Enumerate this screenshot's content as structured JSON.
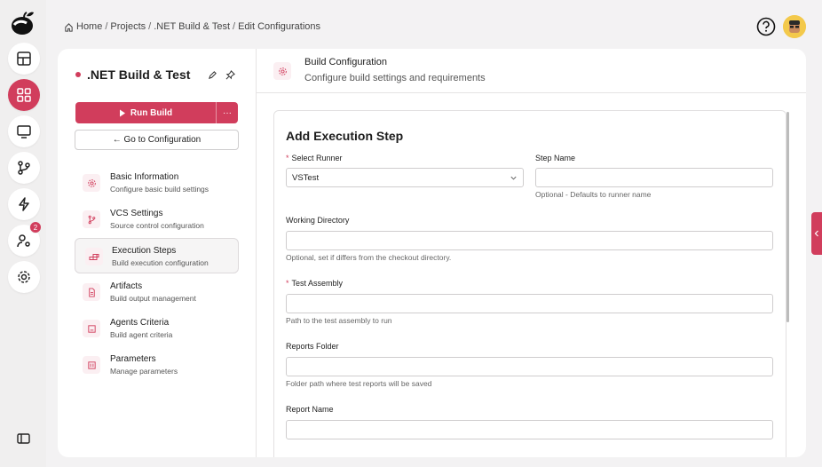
{
  "breadcrumb": [
    "Home",
    "Projects",
    ".NET Build & Test",
    "Edit Configurations"
  ],
  "sidebar": {
    "badge_count": "2"
  },
  "project": {
    "title": ".NET Build & Test",
    "run_label": "Run Build",
    "more_label": "···",
    "goto_label": "← Go to Configuration"
  },
  "nav": [
    {
      "title": "Basic Information",
      "subtitle": "Configure basic build settings",
      "icon": "gear-icon"
    },
    {
      "title": "VCS Settings",
      "subtitle": "Source control configuration",
      "icon": "branch-icon"
    },
    {
      "title": "Execution Steps",
      "subtitle": "Build execution configuration",
      "icon": "steps-icon",
      "active": true
    },
    {
      "title": "Artifacts",
      "subtitle": "Build output management",
      "icon": "file-icon"
    },
    {
      "title": "Agents Criteria",
      "subtitle": "Build agent criteria",
      "icon": "agent-icon"
    },
    {
      "title": "Parameters",
      "subtitle": "Manage parameters",
      "icon": "params-icon"
    }
  ],
  "header": {
    "title": "Build Configuration",
    "subtitle": "Configure build settings and requirements"
  },
  "form": {
    "title": "Add Execution Step",
    "runner": {
      "label": "Select Runner",
      "value": "VSTest"
    },
    "step_name": {
      "label": "Step Name",
      "hint": "Optional - Defaults to runner name"
    },
    "working_dir": {
      "label": "Working Directory",
      "hint": "Optional, set if differs from the checkout directory."
    },
    "test_assembly": {
      "label": "Test Assembly",
      "hint": "Path to the test assembly to run"
    },
    "reports_folder": {
      "label": "Reports Folder",
      "hint": "Folder path where test reports will be saved"
    },
    "report_name": {
      "label": "Report Name"
    }
  },
  "colors": {
    "accent": "#d13d5c",
    "accent_light": "#fbeff2"
  }
}
